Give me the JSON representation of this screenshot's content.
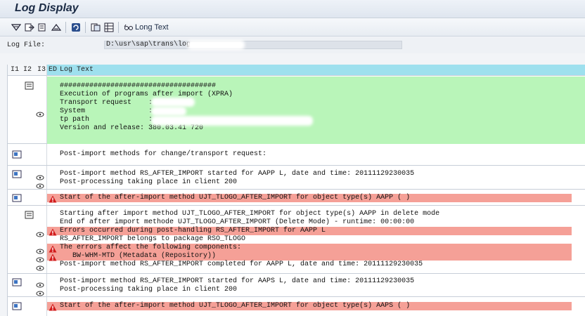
{
  "window": {
    "title": "Log Display"
  },
  "toolbar": {
    "buttons": [
      "expand-all-icon",
      "expand-subtree-icon",
      "collapse-subtree-icon",
      "collapse-all-icon",
      "refresh-icon",
      "export-icon",
      "layout-icon"
    ],
    "long_text_label": "Long Text"
  },
  "logfile": {
    "label": "Log File:",
    "path": "D:\\usr\\sap\\trans\\log"
  },
  "table": {
    "headers": {
      "i1": "I1",
      "i2": "I2",
      "i3": "I3",
      "ed": "ED",
      "logtext": "Log Text"
    },
    "groups": [
      {
        "lines": [
          "#####################################",
          "Execution of programs after import (XPRA)",
          "Transport request    :",
          "System               :",
          "tp path              :",
          "Version and release: 380.03.41 720"
        ]
      },
      {
        "lines": [
          "Post-import methods for change/transport request:"
        ]
      },
      {
        "lines": [
          "Post-import method RS_AFTER_IMPORT started for AAPP L, date and time: 20111129230035",
          "Post-processing taking place in client 200"
        ]
      },
      {
        "lines": [
          "Start of the after-import method UJT_TLOGO_AFTER_IMPORT for object type(s) AAPP ( )"
        ]
      },
      {
        "lines": [
          "Starting after import method UJT_TLOGO_AFTER_IMPORT for object type(s) AAPP in delete mode",
          "End of after import methode UJT_TLOGO_AFTER_IMPORT (Delete Mode) - runtime: 00:00:00",
          "Errors occurred during post-handling RS_AFTER_IMPORT for AAPP L",
          "RS_AFTER_IMPORT belongs to package RSO_TLOGO",
          "The errors affect the following components:",
          "   BW-WHM-MTD (Metadata (Repository))",
          "Post-import method RS_AFTER_IMPORT completed for AAPP L, date and time: 20111129230035"
        ]
      },
      {
        "lines": [
          "Post-import method RS_AFTER_IMPORT started for AAPS L, date and time: 20111129230035",
          "Post-processing taking place in client 200"
        ]
      },
      {
        "lines": [
          "Start of the after-import method UJT_TLOGO_AFTER_IMPORT for object type(s) AAPS ( )"
        ]
      }
    ]
  },
  "colors": {
    "success": "#b9f5b9",
    "error": "#f5a097",
    "header": "#9ee0ee"
  }
}
